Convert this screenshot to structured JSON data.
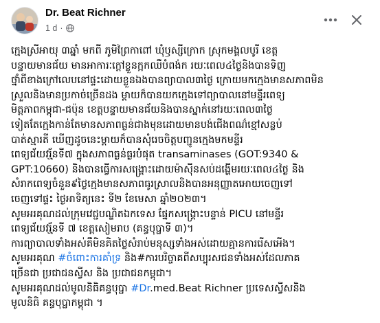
{
  "post": {
    "author": "Dr. Beat Richner",
    "timestamp": "1 d",
    "separator": "·",
    "audience_icon": "globe-icon"
  },
  "actions": {
    "more_icon": "more-horizontal-icon",
    "close_icon": "close-icon"
  },
  "colors": {
    "text": "#050505",
    "meta": "#65676b",
    "hashtag": "#1b74e4"
  },
  "body_lines": [
    [
      {
        "t": "ក្មេងស្រីអាយុ ៣ឆ្នាំ មកពី ភូមិព្រៃកាពៅ ឃុំឫស្សីក្រោក ស្រុកមង្គលបូរី ខេត្ត"
      }
    ],
    [
      {
        "t": "បន្ទាយមានជ័យ មានអាការៈក្តៅខ្លួនក្អកឈឺបំពង់ក រយៈពេល៤ថ្ងៃនិងបានទិញ"
      }
    ],
    [
      {
        "t": "ថ្នាំពីខាងក្រៅលេបនៅផ្ទះដោយខ្លួនឯងបានព្យាបាល៣ថ្ងៃ ក្រោយមកក្មេងមានសភាពមិន"
      }
    ],
    [
      {
        "t": "ស្រួលនិងមានប្រកាច់ច្រើនដង ម្តាយក៏បានយកក្មេងទៅព្យាបាលនៅមន្ទីរពេទ្យ"
      }
    ],
    [
      {
        "t": "មិត្តភាពកម្ពុជា-ជប៉ុន ខេត្តបន្ទាយមានជ័យនិងបានស្នាក់នៅរយៈពេល៣ថ្ងៃ"
      }
    ],
    [
      {
        "t": "ទៀតតែក្មេងកាន់តែមានសភាពធ្ងន់ជាងមុនដោយមានបង់ជើងពណ៌ខ្មៅសន្លប់"
      }
    ],
    [
      {
        "t": "បាត់ស្មារតី ឃើញដូចនេះម្តាយក៏បានសុំរេចចិត្តបញ្ជូនក្មេងមកមន្ទីរ"
      }
    ],
    [
      {
        "t": "ពេទ្យជ័យវរ្ម័នទី៧ ក្នុងសភាពធ្ងន់ធ្ងរបំផុត transaminases (GOT:9340 &"
      }
    ],
    [
      {
        "t": "GPT:10660) និងបានធ្វើការសង្គ្រោះដោយម៉ាស៊ីនសប់ដង្ហើមរយៈពេល៤ថ្ងៃ និង"
      }
    ],
    [
      {
        "t": "សំរាកពេទ្យចំនួន៩ថ្ងៃក្មេងមានសភាពធូរស្រាលនិងបានអនុញ្ញាតអោយចេញទៅ"
      }
    ],
    [
      {
        "t": "ចេញទៅផ្ទះ ថ្ងៃអាទិត្យនេះ ទី២ ខែមេសា ឆ្នាំ២០២៣។"
      }
    ],
    [
      {
        "t": "សូមអរគុណដល់ក្រុមវេជ្ជបណ្ឌិតឯកទេស ផ្នែកសង្គ្រោះបន្ទាន់ PICU នៅមន្ទីរ"
      }
    ],
    [
      {
        "t": "ពេទ្យជ័យវរ្ម័នទី ៧ ខេត្តសៀមរាប (គន្ធបុប្ផាទី ៣)។"
      }
    ],
    [
      {
        "t": "ការព្យាបាលទាំងអស់គឺមិនគិតថ្លៃសំរាប់មនុស្សទាំងអស់ដោយគ្មានការរើសអើង។"
      }
    ],
    [
      {
        "t": "សូមអរគុណ "
      },
      {
        "t": "#ចំពោះការគាំទ្រ",
        "tag": true
      },
      {
        "t": " និង#ការបរិច្ចាគពីសប្បុរសជនទាំងអស់ដែលភាគ"
      }
    ],
    [
      {
        "t": "ច្រើនជា ប្រជាជនស្វីស និង ប្រជាជនកម្ពុជា។"
      }
    ],
    [
      {
        "t": "សូមអរគុណដល់មូលនិធិគន្ធបុប្ផា "
      },
      {
        "t": "#Dr",
        "tag": true
      },
      {
        "t": ".med.Beat Richner ប្រទេសស្វីសនិង"
      }
    ],
    [
      {
        "t": "មូលនិធិ គន្ធបុប្ផាកម្ពុជា ។"
      }
    ]
  ]
}
